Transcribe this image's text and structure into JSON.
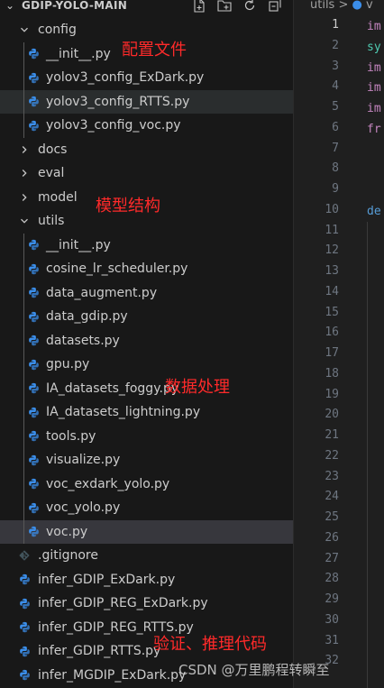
{
  "explorer": {
    "title": "GDIP-YOLO-MAIN",
    "actions": [
      "new-file-icon",
      "new-folder-icon",
      "refresh-icon",
      "collapse-all-icon"
    ],
    "rows": [
      {
        "label": "config",
        "type": "folder",
        "expanded": true,
        "depth": 0
      },
      {
        "label": "__init__.py",
        "type": "py",
        "depth": 1
      },
      {
        "label": "yolov3_config_ExDark.py",
        "type": "py",
        "depth": 1
      },
      {
        "label": "yolov3_config_RTTS.py",
        "type": "py",
        "depth": 1,
        "state": "hover"
      },
      {
        "label": "yolov3_config_voc.py",
        "type": "py",
        "depth": 1
      },
      {
        "label": "docs",
        "type": "folder",
        "expanded": false,
        "depth": 0
      },
      {
        "label": "eval",
        "type": "folder",
        "expanded": false,
        "depth": 0
      },
      {
        "label": "model",
        "type": "folder",
        "expanded": false,
        "depth": 0
      },
      {
        "label": "utils",
        "type": "folder",
        "expanded": true,
        "depth": 0
      },
      {
        "label": "__init__.py",
        "type": "py",
        "depth": 1
      },
      {
        "label": "cosine_lr_scheduler.py",
        "type": "py",
        "depth": 1
      },
      {
        "label": "data_augment.py",
        "type": "py",
        "depth": 1
      },
      {
        "label": "data_gdip.py",
        "type": "py",
        "depth": 1
      },
      {
        "label": "datasets.py",
        "type": "py",
        "depth": 1
      },
      {
        "label": "gpu.py",
        "type": "py",
        "depth": 1
      },
      {
        "label": "IA_datasets_foggy.py",
        "type": "py",
        "depth": 1
      },
      {
        "label": "IA_datasets_lightning.py",
        "type": "py",
        "depth": 1
      },
      {
        "label": "tools.py",
        "type": "py",
        "depth": 1
      },
      {
        "label": "visualize.py",
        "type": "py",
        "depth": 1
      },
      {
        "label": "voc_exdark_yolo.py",
        "type": "py",
        "depth": 1
      },
      {
        "label": "voc_yolo.py",
        "type": "py",
        "depth": 1
      },
      {
        "label": "voc.py",
        "type": "py",
        "depth": 1,
        "state": "active"
      },
      {
        "label": ".gitignore",
        "type": "git",
        "depth": 0
      },
      {
        "label": "infer_GDIP_ExDark.py",
        "type": "py",
        "depth": 0
      },
      {
        "label": "infer_GDIP_REG_ExDark.py",
        "type": "py",
        "depth": 0
      },
      {
        "label": "infer_GDIP_REG_RTTS.py",
        "type": "py",
        "depth": 0
      },
      {
        "label": "infer_GDIP_RTTS.py",
        "type": "py",
        "depth": 0
      },
      {
        "label": "infer_MGDIP_ExDark.py",
        "type": "py",
        "depth": 0
      }
    ]
  },
  "annotations": [
    {
      "text": "配置文件"
    },
    {
      "text": "模型结构"
    },
    {
      "text": "数据处理"
    },
    {
      "text": "验证、推理代码"
    }
  ],
  "editor": {
    "breadcrumb": "utils",
    "breadcrumb_sep": ">",
    "breadcrumb_file": "v",
    "current_line": 1,
    "line_numbers": [
      1,
      2,
      3,
      4,
      5,
      6,
      7,
      8,
      9,
      10,
      11,
      12,
      13,
      14,
      15,
      16,
      17,
      18,
      19,
      20,
      21,
      22,
      23,
      24,
      25,
      26,
      27,
      28,
      29,
      30,
      31,
      32
    ],
    "code": [
      {
        "line": 1,
        "text": "im",
        "color": "#c586c0"
      },
      {
        "line": 2,
        "text": "sy",
        "color": "#4ec9b0"
      },
      {
        "line": 3,
        "text": "im",
        "color": "#c586c0"
      },
      {
        "line": 4,
        "text": "im",
        "color": "#c586c0"
      },
      {
        "line": 5,
        "text": "im",
        "color": "#c586c0"
      },
      {
        "line": 6,
        "text": "fr",
        "color": "#c586c0"
      },
      {
        "line": 10,
        "text": "de",
        "color": "#569cd6"
      }
    ]
  },
  "watermark": "CSDN @万里鹏程转瞬至",
  "colors": {
    "python_icon": "#3b8eea",
    "annotation": "#ff2a2a",
    "active_row": "#37373d",
    "hover_row": "#2a2d2e"
  }
}
